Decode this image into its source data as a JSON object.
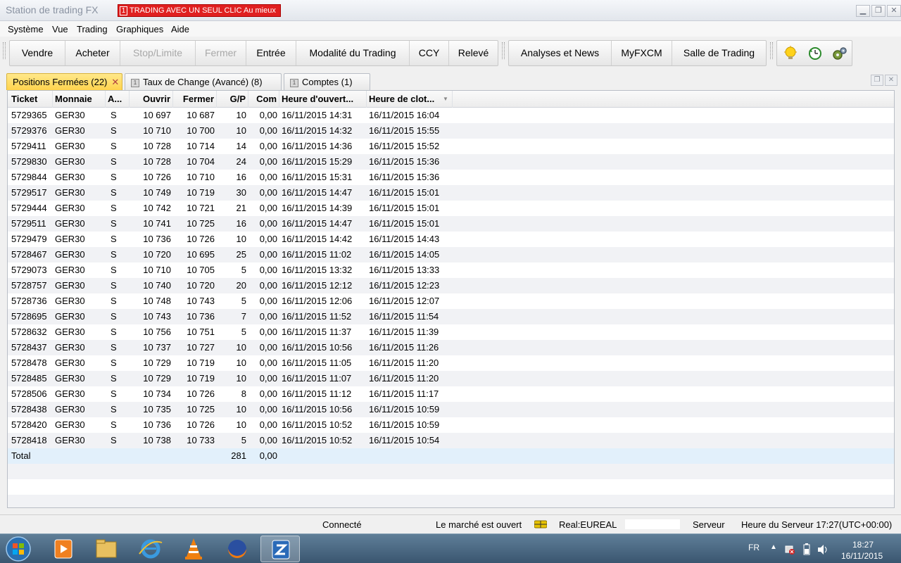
{
  "window": {
    "title": "Station de trading FX",
    "oneclick_num": "1",
    "oneclick_label": "TRADING AVEC UN SEUL CLIC Au mieux"
  },
  "menu": [
    "Système",
    "Vue",
    "Trading",
    "Graphiques",
    "Aide"
  ],
  "toolbar": {
    "group1": [
      "Vendre",
      "Acheter",
      "Stop/Limite",
      "Fermer",
      "Entrée",
      "Modalité du Trading",
      "CCY",
      "Relevé"
    ],
    "disabled": [
      "Stop/Limite",
      "Fermer"
    ],
    "group2": [
      "Analyses et News",
      "MyFXCM",
      "Salle de Trading"
    ],
    "icons": [
      "lightbulb-icon",
      "clock-refresh-icon",
      "gears-icon"
    ]
  },
  "tabs": [
    {
      "label": "Positions Fermées (22)",
      "active": true
    },
    {
      "label": "Taux de Change (Avancé) (8)",
      "active": false
    },
    {
      "label": "Comptes (1)",
      "active": false
    }
  ],
  "chart_data": {
    "type": "table",
    "columns": [
      "Ticket",
      "Monnaie",
      "A...",
      "Ouvrir",
      "Fermer",
      "G/P",
      "Com",
      "Heure d'ouvert...",
      "Heure de clot..."
    ],
    "rows": [
      [
        "5729365",
        "GER30",
        "S",
        "10 697",
        "10 687",
        "10",
        "0,00",
        "16/11/2015 14:31",
        "16/11/2015 16:04"
      ],
      [
        "5729376",
        "GER30",
        "S",
        "10 710",
        "10 700",
        "10",
        "0,00",
        "16/11/2015 14:32",
        "16/11/2015 15:55"
      ],
      [
        "5729411",
        "GER30",
        "S",
        "10 728",
        "10 714",
        "14",
        "0,00",
        "16/11/2015 14:36",
        "16/11/2015 15:52"
      ],
      [
        "5729830",
        "GER30",
        "S",
        "10 728",
        "10 704",
        "24",
        "0,00",
        "16/11/2015 15:29",
        "16/11/2015 15:36"
      ],
      [
        "5729844",
        "GER30",
        "S",
        "10 726",
        "10 710",
        "16",
        "0,00",
        "16/11/2015 15:31",
        "16/11/2015 15:36"
      ],
      [
        "5729517",
        "GER30",
        "S",
        "10 749",
        "10 719",
        "30",
        "0,00",
        "16/11/2015 14:47",
        "16/11/2015 15:01"
      ],
      [
        "5729444",
        "GER30",
        "S",
        "10 742",
        "10 721",
        "21",
        "0,00",
        "16/11/2015 14:39",
        "16/11/2015 15:01"
      ],
      [
        "5729511",
        "GER30",
        "S",
        "10 741",
        "10 725",
        "16",
        "0,00",
        "16/11/2015 14:47",
        "16/11/2015 15:01"
      ],
      [
        "5729479",
        "GER30",
        "S",
        "10 736",
        "10 726",
        "10",
        "0,00",
        "16/11/2015 14:42",
        "16/11/2015 14:43"
      ],
      [
        "5728467",
        "GER30",
        "S",
        "10 720",
        "10 695",
        "25",
        "0,00",
        "16/11/2015 11:02",
        "16/11/2015 14:05"
      ],
      [
        "5729073",
        "GER30",
        "S",
        "10 710",
        "10 705",
        "5",
        "0,00",
        "16/11/2015 13:32",
        "16/11/2015 13:33"
      ],
      [
        "5728757",
        "GER30",
        "S",
        "10 740",
        "10 720",
        "20",
        "0,00",
        "16/11/2015 12:12",
        "16/11/2015 12:23"
      ],
      [
        "5728736",
        "GER30",
        "S",
        "10 748",
        "10 743",
        "5",
        "0,00",
        "16/11/2015 12:06",
        "16/11/2015 12:07"
      ],
      [
        "5728695",
        "GER30",
        "S",
        "10 743",
        "10 736",
        "7",
        "0,00",
        "16/11/2015 11:52",
        "16/11/2015 11:54"
      ],
      [
        "5728632",
        "GER30",
        "S",
        "10 756",
        "10 751",
        "5",
        "0,00",
        "16/11/2015 11:37",
        "16/11/2015 11:39"
      ],
      [
        "5728437",
        "GER30",
        "S",
        "10 737",
        "10 727",
        "10",
        "0,00",
        "16/11/2015 10:56",
        "16/11/2015 11:26"
      ],
      [
        "5728478",
        "GER30",
        "S",
        "10 729",
        "10 719",
        "10",
        "0,00",
        "16/11/2015 11:05",
        "16/11/2015 11:20"
      ],
      [
        "5728485",
        "GER30",
        "S",
        "10 729",
        "10 719",
        "10",
        "0,00",
        "16/11/2015 11:07",
        "16/11/2015 11:20"
      ],
      [
        "5728506",
        "GER30",
        "S",
        "10 734",
        "10 726",
        "8",
        "0,00",
        "16/11/2015 11:12",
        "16/11/2015 11:17"
      ],
      [
        "5728438",
        "GER30",
        "S",
        "10 735",
        "10 725",
        "10",
        "0,00",
        "16/11/2015 10:56",
        "16/11/2015 10:59"
      ],
      [
        "5728420",
        "GER30",
        "S",
        "10 736",
        "10 726",
        "10",
        "0,00",
        "16/11/2015 10:52",
        "16/11/2015 10:59"
      ],
      [
        "5728418",
        "GER30",
        "S",
        "10 738",
        "10 733",
        "5",
        "0,00",
        "16/11/2015 10:52",
        "16/11/2015 10:54"
      ]
    ],
    "total": {
      "label": "Total",
      "gp": "281",
      "com": "0,00"
    }
  },
  "status": {
    "connection": "Connecté",
    "market": "Le marché est ouvert",
    "account": "Real:EUREAL",
    "server": "Serveur",
    "server_time": "Heure du Serveur 17:27(UTC+00:00)"
  },
  "taskbar": {
    "lang": "FR",
    "time": "18:27",
    "date": "16/11/2015",
    "apps": [
      "media-player-icon",
      "explorer-folder-icon",
      "internet-explorer-icon",
      "vlc-icon",
      "firefox-icon",
      "fxcm-app-icon"
    ]
  },
  "colors": {
    "active_tab": "#ffd34d",
    "oneclick_bg": "#e02020",
    "total_row": "#e2f0fb",
    "alt_row": "#f1f2f5"
  }
}
